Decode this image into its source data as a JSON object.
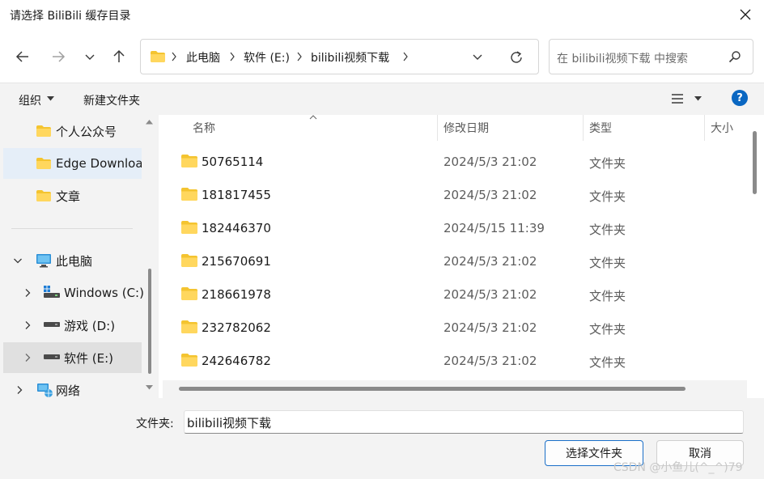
{
  "window": {
    "title": "请选择 BiliBili 缓存目录"
  },
  "address": {
    "crumbs": [
      "此电脑",
      "软件 (E:)",
      "bilibili视频下载"
    ]
  },
  "search": {
    "placeholder": "在 bilibili视频下载 中搜索"
  },
  "commandbar": {
    "organize": "组织",
    "new_folder": "新建文件夹"
  },
  "navpane": {
    "items": [
      {
        "label": "个人公众号",
        "icon": "folder-icon"
      },
      {
        "label": "Edge Downloa",
        "icon": "folder-icon"
      },
      {
        "label": "文章",
        "icon": "folder-icon"
      },
      {
        "label": "此电脑",
        "icon": "computer-icon"
      },
      {
        "label": "Windows (C:)",
        "icon": "windows-drive-icon"
      },
      {
        "label": "游戏 (D:)",
        "icon": "drive-icon"
      },
      {
        "label": "软件 (E:)",
        "icon": "drive-icon"
      },
      {
        "label": "网络",
        "icon": "network-icon"
      }
    ]
  },
  "filelist": {
    "columns": [
      "名称",
      "修改日期",
      "类型",
      "大小"
    ],
    "rows": [
      {
        "name": "50765114",
        "date": "2024/5/3 21:02",
        "type": "文件夹"
      },
      {
        "name": "181817455",
        "date": "2024/5/3 21:02",
        "type": "文件夹"
      },
      {
        "name": "182446370",
        "date": "2024/5/15 11:39",
        "type": "文件夹"
      },
      {
        "name": "215670691",
        "date": "2024/5/3 21:02",
        "type": "文件夹"
      },
      {
        "name": "218661978",
        "date": "2024/5/3 21:02",
        "type": "文件夹"
      },
      {
        "name": "232782062",
        "date": "2024/5/3 21:02",
        "type": "文件夹"
      },
      {
        "name": "242646782",
        "date": "2024/5/3 21:02",
        "type": "文件夹"
      }
    ]
  },
  "footer": {
    "folder_label": "文件夹:",
    "folder_value": "bilibili视频下载",
    "select_button": "选择文件夹",
    "cancel_button": "取消",
    "watermark": "CSDN @小鱼儿(^_^)79"
  },
  "colors": {
    "accent": "#0a67c2",
    "folder": "#f4c430",
    "selected_nav": "#e5eef8"
  }
}
